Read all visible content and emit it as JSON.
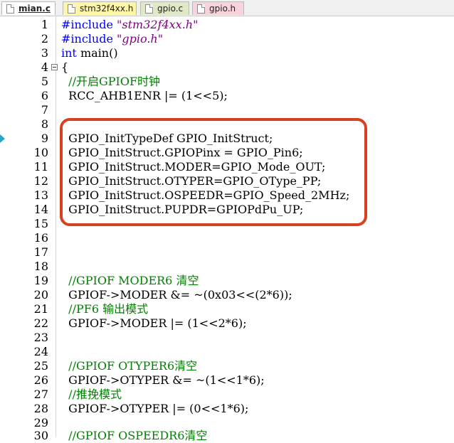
{
  "tabs": [
    {
      "label": "mian.c",
      "active": true,
      "color": "#ffffff"
    },
    {
      "label": "stm32f4xx.h",
      "active": false,
      "color": "#fdf5a8"
    },
    {
      "label": "gpio.c",
      "active": false,
      "color": "#dfe9c6"
    },
    {
      "label": "gpio.h",
      "active": false,
      "color": "#f7d4dc"
    }
  ],
  "lines": [
    {
      "n": "1",
      "a": "#include ",
      "b": "\"stm32f4xx.h\""
    },
    {
      "n": "2",
      "a": "#include ",
      "b": "\"gpio.h\""
    },
    {
      "n": "3",
      "a": "int",
      "b": " main()"
    },
    {
      "n": "4",
      "a": "{"
    },
    {
      "n": "5",
      "a": "  //开启GPIOF时钟"
    },
    {
      "n": "6",
      "a": "  RCC_AHB1ENR |= (1<<5);"
    },
    {
      "n": "7",
      "a": ""
    },
    {
      "n": "8",
      "a": ""
    },
    {
      "n": "9",
      "a": "  GPIO_InitTypeDef GPIO_InitStruct;"
    },
    {
      "n": "10",
      "a": "  GPIO_InitStruct.GPIOPinx = GPIO_Pin6;"
    },
    {
      "n": "11",
      "a": "  GPIO_InitStruct.MODER=GPIO_Mode_OUT;"
    },
    {
      "n": "12",
      "a": "  GPIO_InitStruct.OTYPER=GPIO_OType_PP;"
    },
    {
      "n": "13",
      "a": "  GPIO_InitStruct.OSPEEDR=GPIO_Speed_2MHz;"
    },
    {
      "n": "14",
      "a": "  GPIO_InitStruct.PUPDR=GPIOPdPu_UP;"
    },
    {
      "n": "15",
      "a": ""
    },
    {
      "n": "16",
      "a": ""
    },
    {
      "n": "17",
      "a": ""
    },
    {
      "n": "18",
      "a": ""
    },
    {
      "n": "19",
      "a": "  //GPIOF MODER6 清空"
    },
    {
      "n": "20",
      "a": "  GPIOF->MODER &= ~(0x03<<(2*6));"
    },
    {
      "n": "21",
      "a": "  //PF6 输出模式"
    },
    {
      "n": "22",
      "a": "  GPIOF->MODER |= (1<<2*6);"
    },
    {
      "n": "23",
      "a": ""
    },
    {
      "n": "24",
      "a": ""
    },
    {
      "n": "25",
      "a": "  //GPIOF OTYPER6清空"
    },
    {
      "n": "26",
      "a": "  GPIOF->OTYPER &= ~(1<<1*6);"
    },
    {
      "n": "27",
      "a": "  //推挽模式"
    },
    {
      "n": "28",
      "a": "  GPIOF->OTYPER |= (0<<1*6);"
    },
    {
      "n": "29",
      "a": ""
    },
    {
      "n": "30",
      "a": "  //GPIOF OSPEEDR6清空"
    }
  ]
}
